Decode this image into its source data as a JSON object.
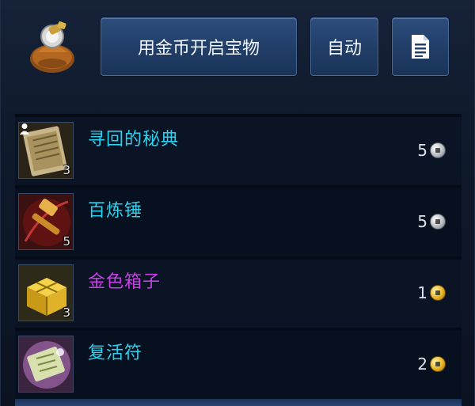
{
  "header": {
    "open_button_label": "用金币开启宝物",
    "auto_button_label": "自动",
    "log_icon": "document-icon",
    "bag_icon": "treasure-bag-icon"
  },
  "items": [
    {
      "name": "寻回的秘典",
      "quantity": "3",
      "cost": "5",
      "currency": "silver",
      "name_color": "#2bd2f0",
      "icon": "ancient-book-icon",
      "bound": true
    },
    {
      "name": "百炼锤",
      "quantity": "5",
      "cost": "5",
      "currency": "silver",
      "name_color": "#2bd2f0",
      "icon": "hammer-icon",
      "bound": false
    },
    {
      "name": "金色箱子",
      "quantity": "3",
      "cost": "1",
      "currency": "gold",
      "name_color": "#c93ee6",
      "icon": "gold-box-icon",
      "bound": false
    },
    {
      "name": "复活符",
      "quantity": "",
      "cost": "2",
      "currency": "gold",
      "name_color": "#2bd2f0",
      "icon": "revive-talisman-icon",
      "bound": false
    }
  ]
}
